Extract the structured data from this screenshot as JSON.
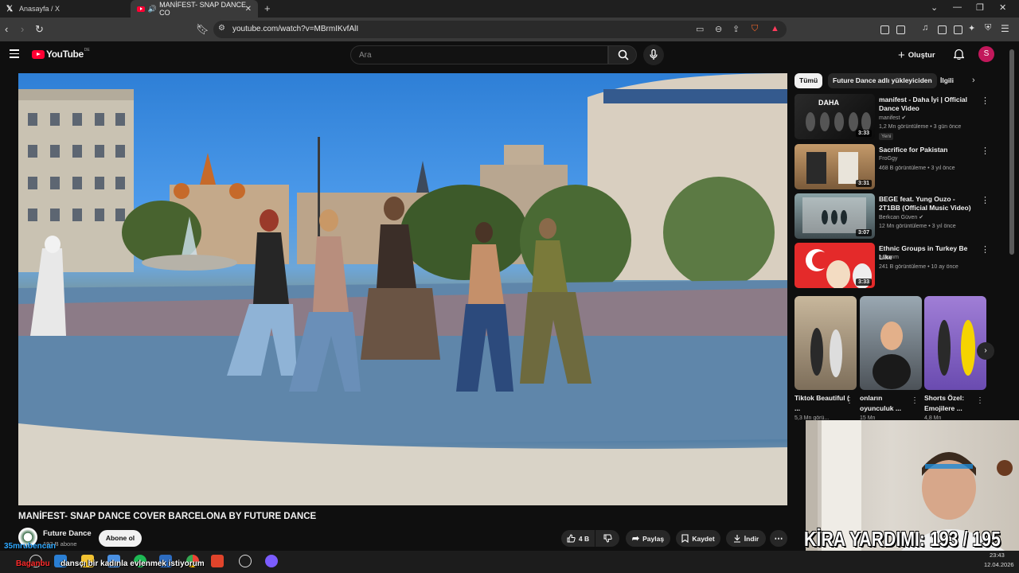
{
  "browser": {
    "tabs": [
      {
        "label": "Anasayfa / X"
      },
      {
        "label": "MANİFEST- SNAP DANCE CO"
      }
    ],
    "url": "youtube.com/watch?v=MBrmIKvfAlI"
  },
  "header": {
    "logo_text": "YouTube",
    "country": "DE",
    "search_placeholder": "Ara",
    "create_label": "Oluştur",
    "avatar_letter": "S"
  },
  "video": {
    "title": "MANİFEST- SNAP DANCE COVER BARCELONA BY FUTURE DANCE",
    "channel": "Future Dance",
    "subscribers": "192 B abone",
    "subscribe_label": "Abone ol",
    "likes": "4 B",
    "share_label": "Paylaş",
    "save_label": "Kaydet",
    "download_label": "İndir"
  },
  "chips": [
    {
      "label": "Tümü"
    },
    {
      "label": "Future Dance adlı yükleyiciden"
    },
    {
      "label": "İlgili"
    }
  ],
  "recommendations": [
    {
      "title": "manifest - Daha İyi | Official Dance Video",
      "channel": "manifest",
      "verified": true,
      "views": "1,2 Mn görüntüleme",
      "age": "3 gün önce",
      "badge": "Yeni",
      "duration": "3:33"
    },
    {
      "title": "Sacrifice for Pakistan",
      "channel": "FroGgy",
      "verified": false,
      "views": "468 B görüntüleme",
      "age": "3 yıl önce",
      "duration": "3:31"
    },
    {
      "title": "BEGE feat. Yung Ouzo - 2T1BB (Official Music Video)",
      "channel": "Berkcan Güven",
      "verified": true,
      "views": "12 Mn görüntüleme",
      "age": "3 yıl önce",
      "duration": "3:07"
    },
    {
      "title": "Ethnic Groups in Turkey Be Like",
      "channel": "nazanm",
      "verified": false,
      "views": "241 B görüntüleme",
      "age": "10 ay önce",
      "duration": "3:33"
    }
  ],
  "shorts": [
    {
      "title": "Tiktok Beautiful ( ...",
      "meta": "5,3 Mn görü..."
    },
    {
      "title": "onların oyunculuk ...",
      "meta": "15 Mn"
    },
    {
      "title": "Shorts Özel: Emojilere ...",
      "meta": "4,8 Mn"
    }
  ],
  "overlay": {
    "counter_text": "KİRA YARDIMI: 193 / 195",
    "chat_user": "35mrubencan",
    "chat_user2": "Baganbu",
    "chat_message": "dansçı bir kadınla evlenmek istiyorum"
  },
  "system": {
    "time": "23:43",
    "date": "12.04.2026"
  },
  "colors": {
    "background": "#0f0f0f",
    "youtube_red": "#ff0033",
    "avatar": "#c2185b"
  }
}
